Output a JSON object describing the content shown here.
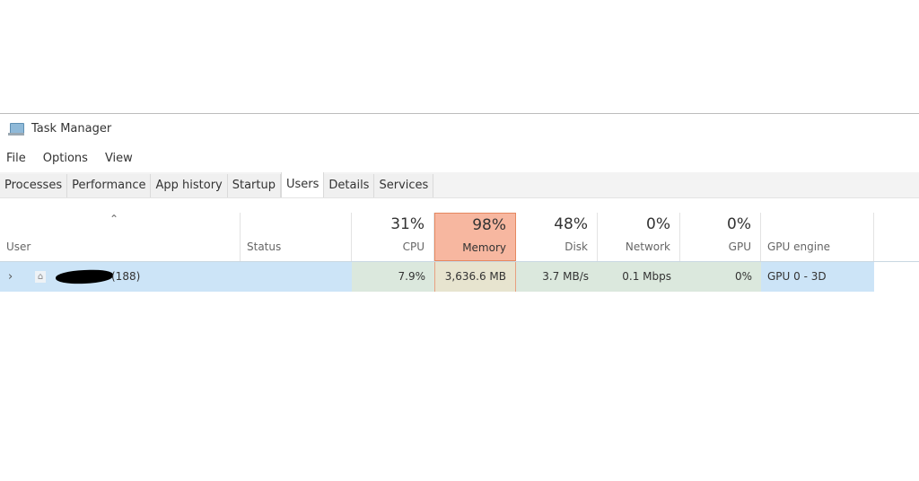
{
  "window": {
    "title": "Task Manager",
    "icon": "task-manager-icon"
  },
  "menu": [
    {
      "label": "File",
      "mnemonic": "F"
    },
    {
      "label": "Options",
      "mnemonic": "O"
    },
    {
      "label": "View",
      "mnemonic": "V"
    }
  ],
  "tabs": [
    {
      "label": "Processes",
      "active": false
    },
    {
      "label": "Performance",
      "active": false
    },
    {
      "label": "App history",
      "active": false
    },
    {
      "label": "Startup",
      "active": false
    },
    {
      "label": "Users",
      "active": true
    },
    {
      "label": "Details",
      "active": false
    },
    {
      "label": "Services",
      "active": false
    }
  ],
  "columns": {
    "user": {
      "label": "User",
      "sort_icon": "chevron-up-icon"
    },
    "status": {
      "label": "Status"
    },
    "cpu": {
      "label": "CPU",
      "percent": "31%"
    },
    "memory": {
      "label": "Memory",
      "percent": "98%",
      "highlight_color": "#f7b7a0"
    },
    "disk": {
      "label": "Disk",
      "percent": "48%"
    },
    "network": {
      "label": "Network",
      "percent": "0%"
    },
    "gpu": {
      "label": "GPU",
      "percent": "0%"
    },
    "gpu_engine": {
      "label": "GPU engine"
    }
  },
  "rows": [
    {
      "user_suffix": "(188)",
      "user_redacted": true,
      "status": "",
      "cpu": "7.9%",
      "memory": "3,636.6 MB",
      "disk": "3.7 MB/s",
      "network": "0.1 Mbps",
      "gpu": "0%",
      "gpu_engine": "GPU 0 - 3D"
    }
  ],
  "colors": {
    "selected_row": "#cce4f7",
    "memory_header": "#f7b7a0",
    "heat_low": "#dbe8dd"
  }
}
